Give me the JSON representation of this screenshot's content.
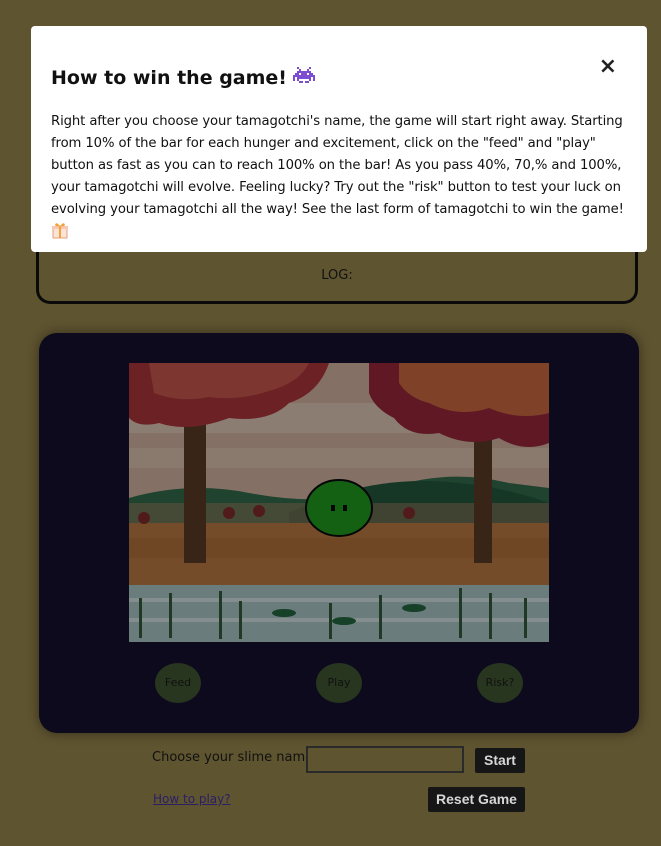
{
  "modal": {
    "title": "How to win the game!",
    "title_icon": "space-invader-icon",
    "body": "Right after you choose your tamagotchi's name, the game will start right away. Starting from 10% of the bar for each hunger and excitement, click on the \"feed\" and \"play\" button as fast as you can to reach 100% on the bar! As you pass 40%, 70,% and 100%, your tamagotchi will evolve. Feeling lucky? Try out the \"risk\" button to test your luck on evolving your tamagotchi all the way! See the last form of tamagotchi to win the game!",
    "body_icon": "gift-icon",
    "close_label": "×"
  },
  "log": {
    "label": "LOG:"
  },
  "game": {
    "feed_label": "Feed",
    "play_label": "Play",
    "risk_label": "Risk?"
  },
  "controls": {
    "name_label": "Choose your slime name:",
    "name_value": "",
    "start_label": "Start",
    "howto_label": "How to play?",
    "reset_label": "Reset Game"
  },
  "colors": {
    "page_background": "#5f5430",
    "device_background": "#0c0a1c",
    "button_green": "#28351f",
    "slime_green": "#16a016"
  }
}
